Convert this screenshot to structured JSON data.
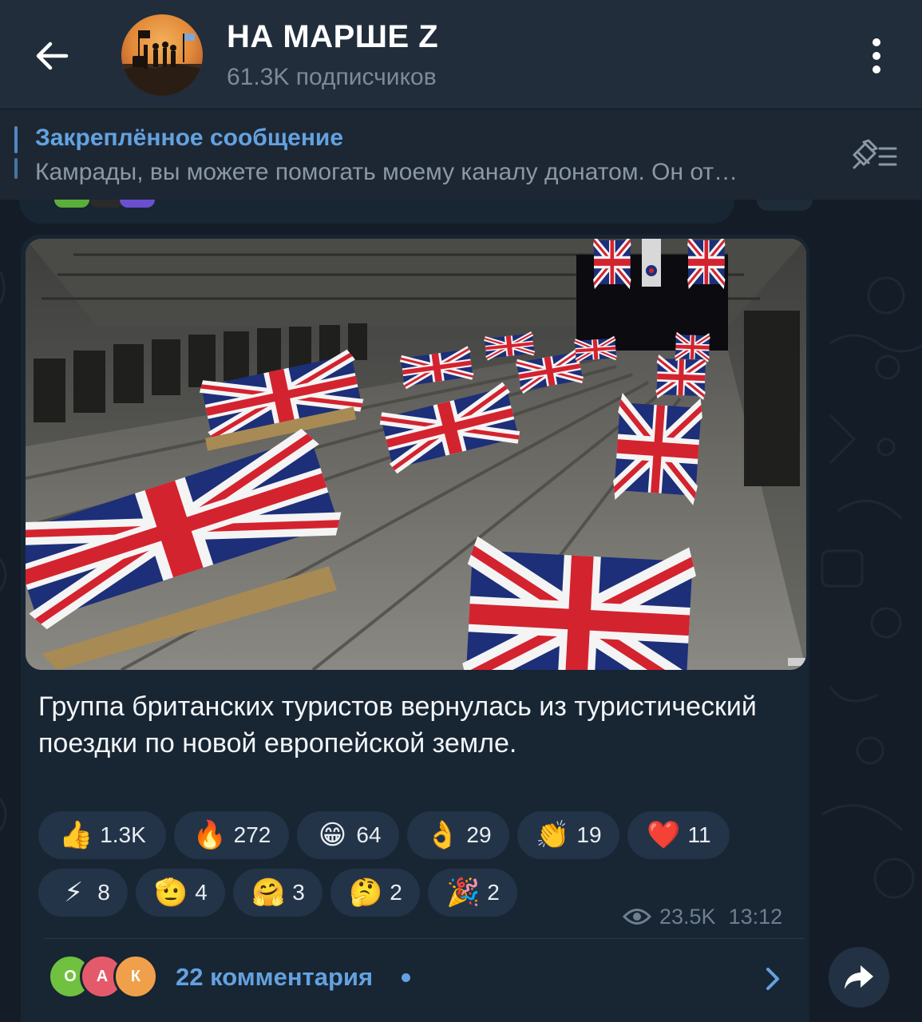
{
  "header": {
    "title": "НА МАРШЕ Z",
    "subscribers": "61.3K подписчиков",
    "back_icon": "arrow-left-icon",
    "menu_icon": "kebab-menu-icon"
  },
  "pinned": {
    "title": "Закреплённое сообщение",
    "text": "Камрады, вы можете помогать моему каналу донатом.  Он от…",
    "unpin_icon": "unpin-list-icon"
  },
  "message": {
    "caption": "Группа британских туристов вернулась из туристический поездки по новой европейской земле.",
    "photo_description_icon": "photo",
    "reactions": [
      {
        "emoji": "👍",
        "count": "1.3K"
      },
      {
        "emoji": "🔥",
        "count": "272"
      },
      {
        "emoji": "😁",
        "count": "64"
      },
      {
        "emoji": "👌",
        "count": "29"
      },
      {
        "emoji": "👏",
        "count": "19"
      },
      {
        "emoji": "❤️",
        "count": "11"
      },
      {
        "emoji": "⚡",
        "count": "8"
      },
      {
        "emoji": "🫡",
        "count": "4"
      },
      {
        "emoji": "🤗",
        "count": "3"
      },
      {
        "emoji": "🤔",
        "count": "2"
      },
      {
        "emoji": "🎉",
        "count": "2"
      }
    ],
    "views": "23.5K",
    "time": "13:12"
  },
  "comments": {
    "label": "22 комментария",
    "avatars": [
      {
        "letter": "О",
        "color": "#6fc13f"
      },
      {
        "letter": "А",
        "color": "#e55a6a"
      },
      {
        "letter": "К",
        "color": "#f0a04b"
      }
    ]
  },
  "colors": {
    "background": "#17212b",
    "header": "#212d3b",
    "bubble": "#182533",
    "accent": "#63a2e0",
    "reaction_bg": "#233448"
  }
}
